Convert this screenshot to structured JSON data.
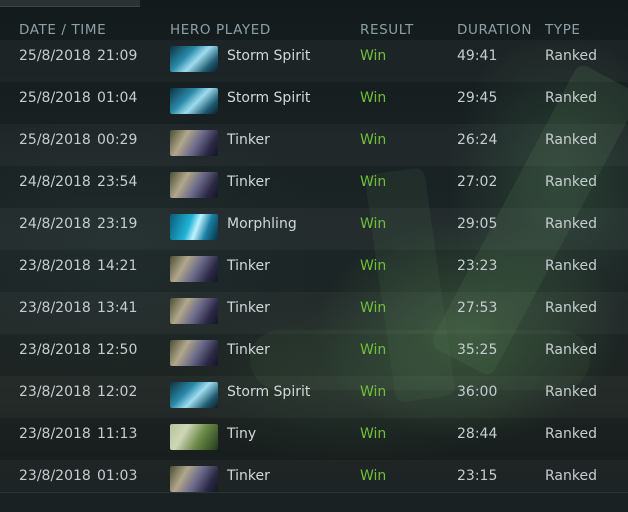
{
  "header": {
    "date_time": "DATE / TIME",
    "hero_played": "HERO PLAYED",
    "result": "RESULT",
    "duration": "DURATION",
    "type": "TYPE"
  },
  "colors": {
    "win": "#6fbf3a",
    "text": "#c6cdd0",
    "header": "#8da0a6"
  },
  "matches": [
    {
      "date": "25/8/2018",
      "time": "21:09",
      "hero": "Storm Spirit",
      "portrait": "storm",
      "result": "Win",
      "duration": "49:41",
      "type": "Ranked"
    },
    {
      "date": "25/8/2018",
      "time": "01:04",
      "hero": "Storm Spirit",
      "portrait": "storm",
      "result": "Win",
      "duration": "29:45",
      "type": "Ranked"
    },
    {
      "date": "25/8/2018",
      "time": "00:29",
      "hero": "Tinker",
      "portrait": "tinker",
      "result": "Win",
      "duration": "26:24",
      "type": "Ranked"
    },
    {
      "date": "24/8/2018",
      "time": "23:54",
      "hero": "Tinker",
      "portrait": "tinker",
      "result": "Win",
      "duration": "27:02",
      "type": "Ranked"
    },
    {
      "date": "24/8/2018",
      "time": "23:19",
      "hero": "Morphling",
      "portrait": "morph",
      "result": "Win",
      "duration": "29:05",
      "type": "Ranked"
    },
    {
      "date": "23/8/2018",
      "time": "14:21",
      "hero": "Tinker",
      "portrait": "tinker",
      "result": "Win",
      "duration": "23:23",
      "type": "Ranked"
    },
    {
      "date": "23/8/2018",
      "time": "13:41",
      "hero": "Tinker",
      "portrait": "tinker",
      "result": "Win",
      "duration": "27:53",
      "type": "Ranked"
    },
    {
      "date": "23/8/2018",
      "time": "12:50",
      "hero": "Tinker",
      "portrait": "tinker",
      "result": "Win",
      "duration": "35:25",
      "type": "Ranked"
    },
    {
      "date": "23/8/2018",
      "time": "12:02",
      "hero": "Storm Spirit",
      "portrait": "storm",
      "result": "Win",
      "duration": "36:00",
      "type": "Ranked"
    },
    {
      "date": "23/8/2018",
      "time": "11:13",
      "hero": "Tiny",
      "portrait": "tiny",
      "result": "Win",
      "duration": "28:44",
      "type": "Ranked"
    },
    {
      "date": "23/8/2018",
      "time": "01:03",
      "hero": "Tinker",
      "portrait": "tinker",
      "result": "Win",
      "duration": "23:15",
      "type": "Ranked"
    }
  ]
}
